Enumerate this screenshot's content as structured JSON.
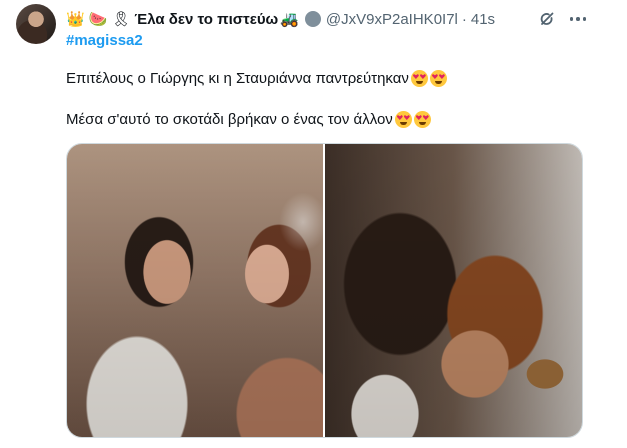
{
  "author": {
    "emojis": [
      "👑",
      "🍉",
      "🎗"
    ],
    "display_name": "Έλα δεν το πιστεύω",
    "name_emoji": "🚜",
    "handle": "@JxV9xP2aIHK0I7l",
    "separator": "·",
    "time": "41s"
  },
  "tweet": {
    "hashtag": "#magissa2",
    "line1": "Επιτέλους ο Γιώργης κι η Σταυριάννα παντρεύτηκαν",
    "line2": "Μέσα σ'αυτό το σκοτάδι βρήκαν ο ένας τον άλλον",
    "line_emoji": "heart-eyes-emoji"
  },
  "icons": {
    "grok": "grok-icon",
    "more": "more-icon",
    "verified": "verified-badge",
    "accent": "#1d9bf0",
    "muted": "#536471"
  }
}
